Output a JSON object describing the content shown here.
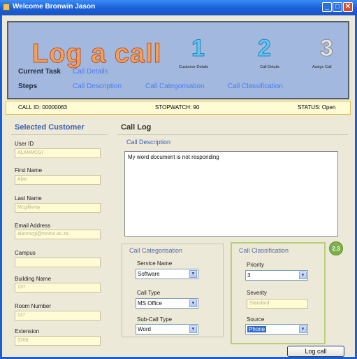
{
  "window": {
    "title": "Welcome Bronwin Jason"
  },
  "header": {
    "title": "Log a call",
    "steps": [
      {
        "number": "1",
        "label": "Customer Details"
      },
      {
        "number": "2",
        "label": "Call Details"
      },
      {
        "number": "3",
        "label": "Assign Call"
      }
    ],
    "current_task_label": "Current Task",
    "current_task_value": "Call Details",
    "steps_label": "Steps",
    "step_links": [
      "Call Description",
      "Call Categorisation",
      "Call Classification"
    ]
  },
  "infobar": {
    "call_id": "CALL ID:  00000063",
    "stopwatch": "STOPWATCH:  90",
    "status": "STATUS: Open"
  },
  "customer": {
    "title": "Selected Customer",
    "fields": [
      {
        "label": "User ID",
        "value": "ALANMCGI"
      },
      {
        "label": "First Name",
        "value": "Alan"
      },
      {
        "label": "Last Name",
        "value": "Mcgillivray"
      },
      {
        "label": "Email Address",
        "value": "alanmcgi@mnmc.ac.za"
      },
      {
        "label": "Campus",
        "value": ""
      },
      {
        "label": "Building Name",
        "value": "137"
      },
      {
        "label": "Room Number",
        "value": "117"
      },
      {
        "label": "Extension",
        "value": "3206"
      }
    ]
  },
  "call_log": {
    "title": "Call Log",
    "description_label": "Call Description",
    "description_text": "My word document is not responding",
    "categorisation": {
      "title": "Call Categorisation",
      "service_label": "Service Name",
      "service_value": "Software",
      "type_label": "Call Type",
      "type_value": "MS Office",
      "subtype_label": "Sub-Call Type",
      "subtype_value": "Word"
    },
    "classification": {
      "title": "Call Classification",
      "priority_label": "Priority",
      "priority_value": "3",
      "severity_label": "Severity",
      "severity_value": "Standard",
      "source_label": "Source",
      "source_value": "Phone"
    },
    "badge": "2.3",
    "submit_label": "Log call"
  },
  "colors": {
    "titlebar": "#1b5fd6",
    "header_bg": "#a3b8de",
    "accent_blue": "#4a7cf0",
    "field_bg": "#fefbd5",
    "badge": "#7db24a"
  }
}
